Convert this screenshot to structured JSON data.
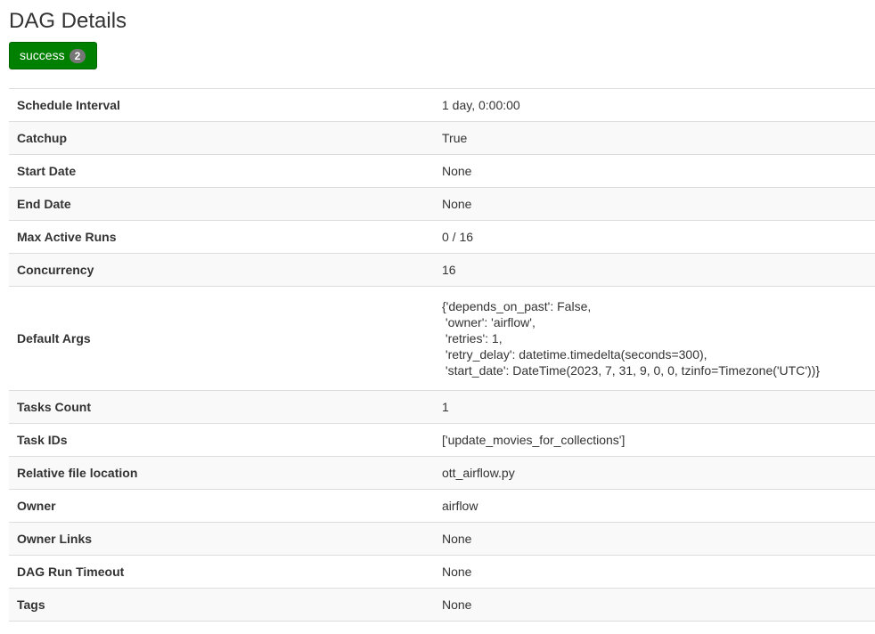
{
  "page": {
    "title": "DAG Details"
  },
  "status": {
    "label": "success",
    "count": "2",
    "color": "#008000"
  },
  "details": [
    {
      "key": "Schedule Interval",
      "value": "1 day, 0:00:00"
    },
    {
      "key": "Catchup",
      "value": "True"
    },
    {
      "key": "Start Date",
      "value": "None"
    },
    {
      "key": "End Date",
      "value": "None"
    },
    {
      "key": "Max Active Runs",
      "value": "0 / 16"
    },
    {
      "key": "Concurrency",
      "value": "16"
    },
    {
      "key": "Default Args",
      "lines": [
        "{'depends_on_past': False,",
        " 'owner': 'airflow',",
        " 'retries': 1,",
        " 'retry_delay': datetime.timedelta(seconds=300),",
        " 'start_date': DateTime(2023, 7, 31, 9, 0, 0, tzinfo=Timezone('UTC'))}"
      ]
    },
    {
      "key": "Tasks Count",
      "value": "1"
    },
    {
      "key": "Task IDs",
      "value": "['update_movies_for_collections']"
    },
    {
      "key": "Relative file location",
      "value": "ott_airflow.py"
    },
    {
      "key": "Owner",
      "value": "airflow"
    },
    {
      "key": "Owner Links",
      "value": "None"
    },
    {
      "key": "DAG Run Timeout",
      "value": "None"
    },
    {
      "key": "Tags",
      "value": "None"
    }
  ]
}
